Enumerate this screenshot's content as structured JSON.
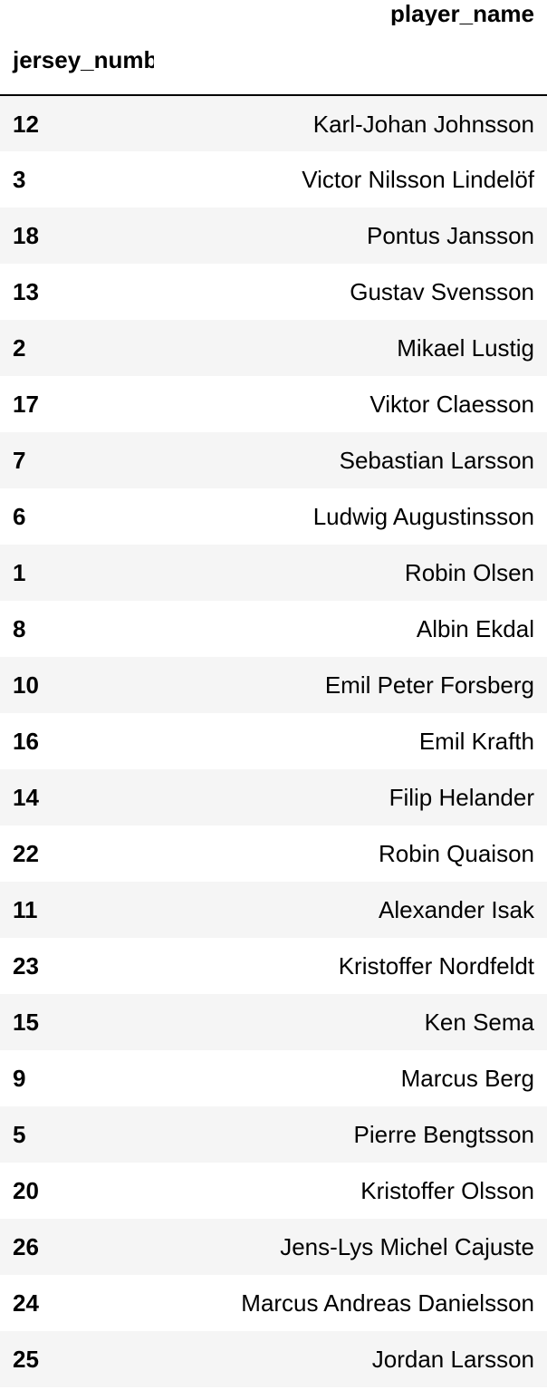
{
  "table": {
    "column_header": "player_name",
    "index_name": "jersey_number",
    "rows": [
      {
        "jersey_number": "12",
        "player_name": "Karl-Johan Johnsson"
      },
      {
        "jersey_number": "3",
        "player_name": "Victor Nilsson Lindelöf"
      },
      {
        "jersey_number": "18",
        "player_name": "Pontus Jansson"
      },
      {
        "jersey_number": "13",
        "player_name": "Gustav Svensson"
      },
      {
        "jersey_number": "2",
        "player_name": "Mikael Lustig"
      },
      {
        "jersey_number": "17",
        "player_name": "Viktor Claesson"
      },
      {
        "jersey_number": "7",
        "player_name": "Sebastian Larsson"
      },
      {
        "jersey_number": "6",
        "player_name": "Ludwig Augustinsson"
      },
      {
        "jersey_number": "1",
        "player_name": "Robin Olsen"
      },
      {
        "jersey_number": "8",
        "player_name": "Albin Ekdal"
      },
      {
        "jersey_number": "10",
        "player_name": "Emil Peter Forsberg"
      },
      {
        "jersey_number": "16",
        "player_name": "Emil Krafth"
      },
      {
        "jersey_number": "14",
        "player_name": "Filip Helander"
      },
      {
        "jersey_number": "22",
        "player_name": "Robin Quaison"
      },
      {
        "jersey_number": "11",
        "player_name": "Alexander Isak"
      },
      {
        "jersey_number": "23",
        "player_name": "Kristoffer Nordfeldt"
      },
      {
        "jersey_number": "15",
        "player_name": "Ken Sema"
      },
      {
        "jersey_number": "9",
        "player_name": "Marcus Berg"
      },
      {
        "jersey_number": "5",
        "player_name": "Pierre Bengtsson"
      },
      {
        "jersey_number": "20",
        "player_name": "Kristoffer Olsson"
      },
      {
        "jersey_number": "26",
        "player_name": "Jens-Lys Michel Cajuste"
      },
      {
        "jersey_number": "24",
        "player_name": "Marcus Andreas Danielsson"
      },
      {
        "jersey_number": "25",
        "player_name": "Jordan Larsson"
      }
    ]
  }
}
